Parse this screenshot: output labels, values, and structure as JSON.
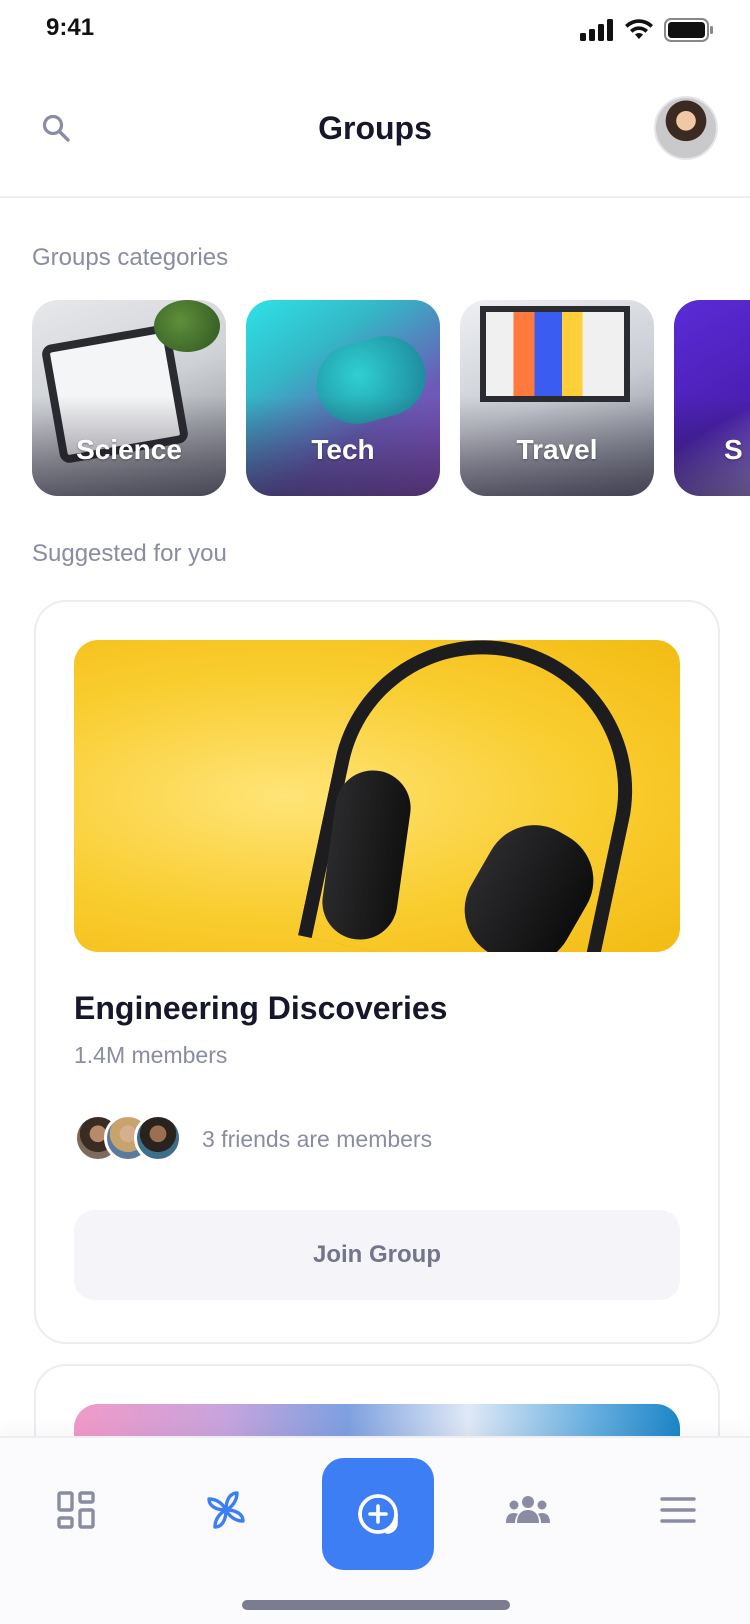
{
  "status_bar": {
    "time": "9:41"
  },
  "header": {
    "title": "Groups",
    "search_icon": "search-icon",
    "avatar_icon": "avatar"
  },
  "categories_section": {
    "label": "Groups categories",
    "items": [
      {
        "label": "Science"
      },
      {
        "label": "Tech"
      },
      {
        "label": "Travel"
      },
      {
        "label": "S"
      }
    ]
  },
  "suggested_section": {
    "label": "Suggested for you",
    "cards": [
      {
        "title": "Engineering Discoveries",
        "members": "1.4M members",
        "friends_text": "3 friends are members",
        "join_label": "Join Group"
      }
    ]
  },
  "bottom_nav": {
    "items": [
      {
        "name": "dashboard",
        "icon": "dashboard-icon"
      },
      {
        "name": "explore",
        "icon": "pinwheel-icon"
      },
      {
        "name": "create",
        "icon": "plus-circle-icon"
      },
      {
        "name": "groups",
        "icon": "people-icon"
      },
      {
        "name": "menu",
        "icon": "hamburger-menu-icon"
      }
    ]
  },
  "colors": {
    "accent": "#3e7ef5",
    "text_primary": "#16172a",
    "text_secondary": "#8a8ca3",
    "button_bg": "#f5f5f9",
    "icon_muted": "#8a8ca3"
  }
}
